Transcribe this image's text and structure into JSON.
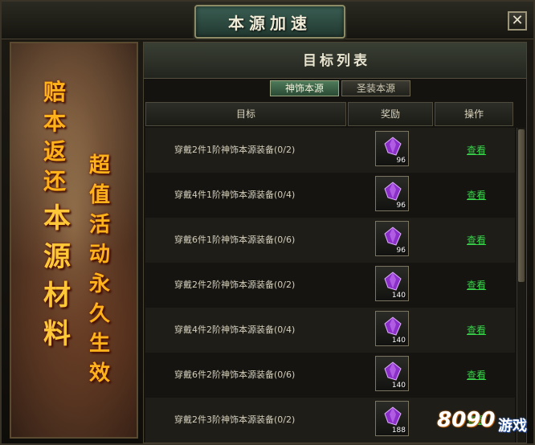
{
  "window": {
    "title": "本源加速",
    "close_icon": "✕"
  },
  "banner": {
    "column_a": [
      "赔",
      "本",
      "返",
      "还"
    ],
    "column_b": [
      "本",
      "源",
      "材",
      "料"
    ],
    "column_c": [
      "超",
      "值",
      "活",
      "动",
      "永",
      "久",
      "生",
      "效"
    ]
  },
  "panel": {
    "section_title": "目标列表",
    "tabs": [
      {
        "label": "神饰本源",
        "active": true
      },
      {
        "label": "圣装本源",
        "active": false
      }
    ],
    "columns": {
      "target": "目标",
      "reward": "奖励",
      "action": "操作"
    },
    "rows": [
      {
        "task": "穿戴2件1阶神饰本源装备(0/2)",
        "reward_icon": "purple-gem-icon",
        "reward_count": "96",
        "action": "查看"
      },
      {
        "task": "穿戴4件1阶神饰本源装备(0/4)",
        "reward_icon": "purple-gem-icon",
        "reward_count": "96",
        "action": "查看"
      },
      {
        "task": "穿戴6件1阶神饰本源装备(0/6)",
        "reward_icon": "purple-gem-icon",
        "reward_count": "96",
        "action": "查看"
      },
      {
        "task": "穿戴2件2阶神饰本源装备(0/2)",
        "reward_icon": "purple-gem-icon",
        "reward_count": "140",
        "action": "查看"
      },
      {
        "task": "穿戴4件2阶神饰本源装备(0/4)",
        "reward_icon": "purple-gem-icon",
        "reward_count": "140",
        "action": "查看"
      },
      {
        "task": "穿戴6件2阶神饰本源装备(0/6)",
        "reward_icon": "purple-gem-icon",
        "reward_count": "140",
        "action": "查看"
      },
      {
        "task": "穿戴2件3阶神饰本源装备(0/2)",
        "reward_icon": "purple-gem-icon",
        "reward_count": "188",
        "action": "查看"
      }
    ]
  },
  "watermark": {
    "number": "8090",
    "word": "游戏"
  },
  "colors": {
    "link_green": "#38d24a",
    "banner_gold": "#ffb21a",
    "gem_purple": "#9a3cd8"
  }
}
